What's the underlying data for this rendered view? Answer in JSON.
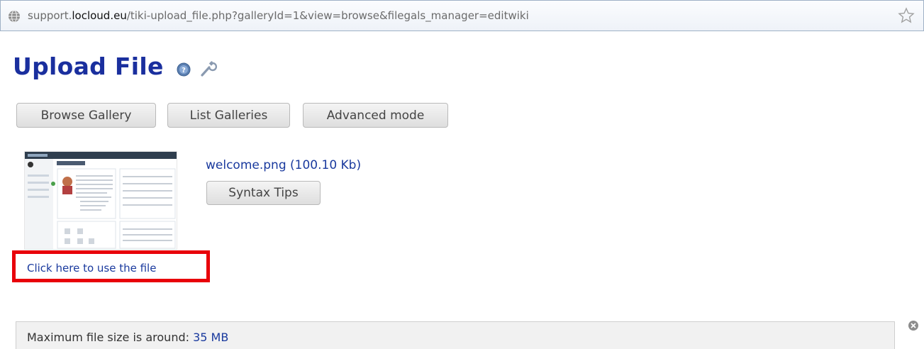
{
  "browser": {
    "url_prefix": "support.",
    "url_domain": "locloud.eu",
    "url_path": "/tiki-upload_file.php?galleryId=1&view=browse&filegals_manager=editwiki"
  },
  "page": {
    "title": "Upload File"
  },
  "toolbar": {
    "browse_gallery": "Browse Gallery",
    "list_galleries": "List Galleries",
    "advanced_mode": "Advanced mode"
  },
  "upload": {
    "file_link": "welcome.png (100.10 Kb)",
    "syntax_tips": "Syntax Tips",
    "use_file_link": "Click here to use the file"
  },
  "limits": {
    "label": "Maximum file size is around: ",
    "value": "35 MB"
  },
  "colors": {
    "title": "#1a2f9e",
    "link": "#1a3a9e",
    "highlight": "#e8000a"
  }
}
